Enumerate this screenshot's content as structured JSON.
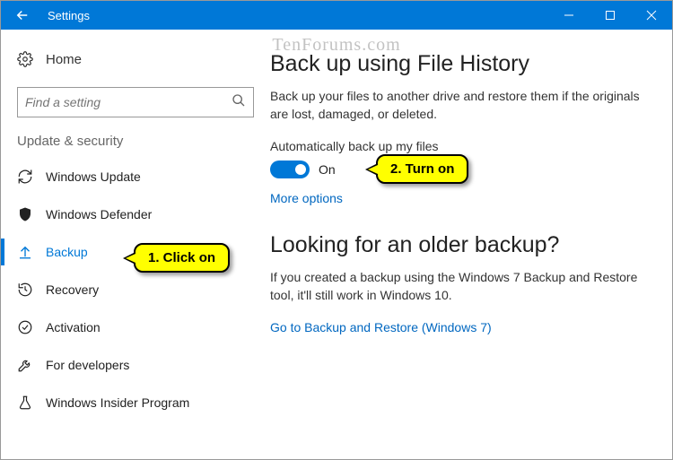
{
  "titlebar": {
    "title": "Settings"
  },
  "sidebar": {
    "home_label": "Home",
    "search_placeholder": "Find a setting",
    "section_header": "Update & security",
    "items": [
      {
        "label": "Windows Update"
      },
      {
        "label": "Windows Defender"
      },
      {
        "label": "Backup"
      },
      {
        "label": "Recovery"
      },
      {
        "label": "Activation"
      },
      {
        "label": "For developers"
      },
      {
        "label": "Windows Insider Program"
      }
    ]
  },
  "main": {
    "section1_title": "Back up using File History",
    "section1_desc": "Back up your files to another drive and restore them if the originals are lost, damaged, or deleted.",
    "auto_backup_label": "Automatically back up my files",
    "toggle_state": "On",
    "more_options": "More options",
    "section2_title": "Looking for an older backup?",
    "section2_desc": "If you created a backup using the Windows 7 Backup and Restore tool, it'll still work in Windows 10.",
    "restore_link": "Go to Backup and Restore (Windows 7)"
  },
  "annotations": {
    "callout1": "1. Click on",
    "callout2": "2. Turn on",
    "watermark": "TenForums.com"
  }
}
